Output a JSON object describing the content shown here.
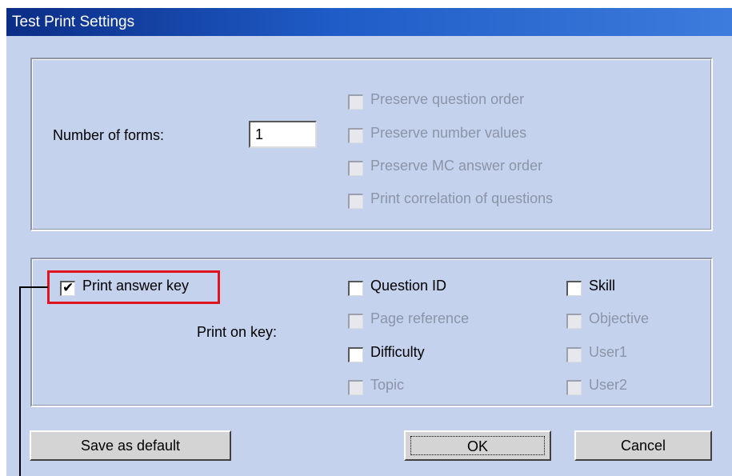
{
  "window": {
    "title": "Test Print Settings"
  },
  "forms_section": {
    "number_of_forms_label": "Number of forms:",
    "number_of_forms_value": "1",
    "options": [
      {
        "label": "Preserve question order",
        "checked": false,
        "enabled": false
      },
      {
        "label": "Preserve number values",
        "checked": false,
        "enabled": false
      },
      {
        "label": "Preserve MC answer order",
        "checked": false,
        "enabled": false
      },
      {
        "label": "Print correlation of questions",
        "checked": false,
        "enabled": false
      }
    ]
  },
  "key_section": {
    "print_answer_key_label": "Print answer key",
    "print_answer_key_checked": true,
    "print_on_key_label": "Print on key:",
    "options": [
      {
        "label": "Question ID",
        "checked": false,
        "enabled": true
      },
      {
        "label": "Page reference",
        "checked": false,
        "enabled": false
      },
      {
        "label": "Difficulty",
        "checked": false,
        "enabled": true
      },
      {
        "label": "Topic",
        "checked": false,
        "enabled": false
      },
      {
        "label": "Skill",
        "checked": false,
        "enabled": true
      },
      {
        "label": "Objective",
        "checked": false,
        "enabled": false
      },
      {
        "label": "User1",
        "checked": false,
        "enabled": false
      },
      {
        "label": "User2",
        "checked": false,
        "enabled": false
      }
    ]
  },
  "buttons": {
    "save_default": "Save as default",
    "ok": "OK",
    "cancel": "Cancel"
  },
  "glyphs": {
    "check": "✔"
  },
  "colors": {
    "highlight": "#e0141e",
    "dialog_bg": "#c4d2ee"
  }
}
